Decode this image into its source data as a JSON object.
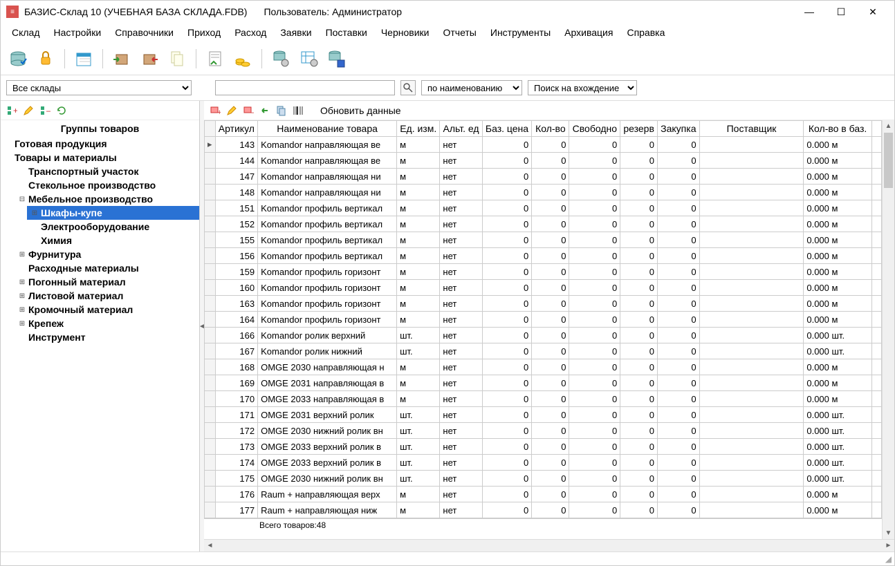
{
  "title": "БАЗИС-Склад 10 (УЧЕБНАЯ БАЗА СКЛАДА.FDB)",
  "user_label": "Пользователь: Администратор",
  "menus": [
    "Склад",
    "Настройки",
    "Справочники",
    "Приход",
    "Расход",
    "Заявки",
    "Поставки",
    "Черновики",
    "Отчеты",
    "Инструменты",
    "Архивация",
    "Справка"
  ],
  "filter": {
    "warehouse_selected": "Все склады",
    "search_value": "",
    "mode_selected": "по наименованию",
    "match_selected": "Поиск на вхождение"
  },
  "sidebar": {
    "title": "Группы товаров",
    "root": [
      {
        "label": "Готовая продукция",
        "children": [],
        "expandable": false
      },
      {
        "label": "Товары и материалы",
        "expanded": true,
        "children": [
          {
            "label": "Транспортный участок"
          },
          {
            "label": "Стекольное производство"
          },
          {
            "label": "Мебельное производство",
            "expandable": true,
            "expanded": true,
            "children": [
              {
                "label": "Шкафы-купе",
                "expandable": true,
                "selected": true
              },
              {
                "label": "Электрооборудование"
              },
              {
                "label": "Химия"
              }
            ]
          },
          {
            "label": "Фурнитура",
            "expandable": true
          },
          {
            "label": "Расходные материалы"
          },
          {
            "label": "Погонный материал",
            "expandable": true
          },
          {
            "label": "Листовой материал",
            "expandable": true
          },
          {
            "label": "Кромочный материал",
            "expandable": true
          },
          {
            "label": "Крепеж",
            "expandable": true
          },
          {
            "label": "Инструмент"
          }
        ]
      }
    ]
  },
  "content_tools": {
    "refresh_label": "Обновить данные"
  },
  "columns": [
    "Артикул",
    "Наименование товара",
    "Ед. изм.",
    "Альт. ед",
    "Баз. цена",
    "Кол-во",
    "Свободно",
    "резерв",
    "Закупка",
    "Поставщик",
    "Кол-во в баз."
  ],
  "rows": [
    {
      "art": "143",
      "name": "Komandor направляющая ве",
      "unit": "м",
      "alt": "нет",
      "price": "0",
      "qty": "0",
      "free": "0",
      "res": "0",
      "buy": "0",
      "sup": "",
      "base": "0.000 м"
    },
    {
      "art": "144",
      "name": "Komandor направляющая ве",
      "unit": "м",
      "alt": "нет",
      "price": "0",
      "qty": "0",
      "free": "0",
      "res": "0",
      "buy": "0",
      "sup": "",
      "base": "0.000 м"
    },
    {
      "art": "147",
      "name": "Komandor направляющая ни",
      "unit": "м",
      "alt": "нет",
      "price": "0",
      "qty": "0",
      "free": "0",
      "res": "0",
      "buy": "0",
      "sup": "",
      "base": "0.000 м"
    },
    {
      "art": "148",
      "name": "Komandor направляющая ни",
      "unit": "м",
      "alt": "нет",
      "price": "0",
      "qty": "0",
      "free": "0",
      "res": "0",
      "buy": "0",
      "sup": "",
      "base": "0.000 м"
    },
    {
      "art": "151",
      "name": "Komandor профиль вертикал",
      "unit": "м",
      "alt": "нет",
      "price": "0",
      "qty": "0",
      "free": "0",
      "res": "0",
      "buy": "0",
      "sup": "",
      "base": "0.000 м"
    },
    {
      "art": "152",
      "name": "Komandor профиль вертикал",
      "unit": "м",
      "alt": "нет",
      "price": "0",
      "qty": "0",
      "free": "0",
      "res": "0",
      "buy": "0",
      "sup": "",
      "base": "0.000 м"
    },
    {
      "art": "155",
      "name": "Komandor профиль вертикал",
      "unit": "м",
      "alt": "нет",
      "price": "0",
      "qty": "0",
      "free": "0",
      "res": "0",
      "buy": "0",
      "sup": "",
      "base": "0.000 м"
    },
    {
      "art": "156",
      "name": "Komandor профиль вертикал",
      "unit": "м",
      "alt": "нет",
      "price": "0",
      "qty": "0",
      "free": "0",
      "res": "0",
      "buy": "0",
      "sup": "",
      "base": "0.000 м"
    },
    {
      "art": "159",
      "name": "Komandor профиль горизонт",
      "unit": "м",
      "alt": "нет",
      "price": "0",
      "qty": "0",
      "free": "0",
      "res": "0",
      "buy": "0",
      "sup": "",
      "base": "0.000 м"
    },
    {
      "art": "160",
      "name": "Komandor профиль горизонт",
      "unit": "м",
      "alt": "нет",
      "price": "0",
      "qty": "0",
      "free": "0",
      "res": "0",
      "buy": "0",
      "sup": "",
      "base": "0.000 м"
    },
    {
      "art": "163",
      "name": "Komandor профиль горизонт",
      "unit": "м",
      "alt": "нет",
      "price": "0",
      "qty": "0",
      "free": "0",
      "res": "0",
      "buy": "0",
      "sup": "",
      "base": "0.000 м"
    },
    {
      "art": "164",
      "name": "Komandor профиль горизонт",
      "unit": "м",
      "alt": "нет",
      "price": "0",
      "qty": "0",
      "free": "0",
      "res": "0",
      "buy": "0",
      "sup": "",
      "base": "0.000 м"
    },
    {
      "art": "166",
      "name": "Komandor ролик верхний",
      "unit": "шт.",
      "alt": "нет",
      "price": "0",
      "qty": "0",
      "free": "0",
      "res": "0",
      "buy": "0",
      "sup": "",
      "base": "0.000 шт."
    },
    {
      "art": "167",
      "name": "Komandor ролик нижний",
      "unit": "шт.",
      "alt": "нет",
      "price": "0",
      "qty": "0",
      "free": "0",
      "res": "0",
      "buy": "0",
      "sup": "",
      "base": "0.000 шт."
    },
    {
      "art": "168",
      "name": "OMGE 2030 направляющая н",
      "unit": "м",
      "alt": "нет",
      "price": "0",
      "qty": "0",
      "free": "0",
      "res": "0",
      "buy": "0",
      "sup": "",
      "base": "0.000 м"
    },
    {
      "art": "169",
      "name": "OMGE 2031 направляющая в",
      "unit": "м",
      "alt": "нет",
      "price": "0",
      "qty": "0",
      "free": "0",
      "res": "0",
      "buy": "0",
      "sup": "",
      "base": "0.000 м"
    },
    {
      "art": "170",
      "name": "OMGE 2033 направляющая в",
      "unit": "м",
      "alt": "нет",
      "price": "0",
      "qty": "0",
      "free": "0",
      "res": "0",
      "buy": "0",
      "sup": "",
      "base": "0.000 м"
    },
    {
      "art": "171",
      "name": "OMGE 2031 верхний ролик",
      "unit": "шт.",
      "alt": "нет",
      "price": "0",
      "qty": "0",
      "free": "0",
      "res": "0",
      "buy": "0",
      "sup": "",
      "base": "0.000 шт."
    },
    {
      "art": "172",
      "name": "OMGE 2030 нижний ролик вн",
      "unit": "шт.",
      "alt": "нет",
      "price": "0",
      "qty": "0",
      "free": "0",
      "res": "0",
      "buy": "0",
      "sup": "",
      "base": "0.000 шт."
    },
    {
      "art": "173",
      "name": "OMGE 2033 верхний ролик в",
      "unit": "шт.",
      "alt": "нет",
      "price": "0",
      "qty": "0",
      "free": "0",
      "res": "0",
      "buy": "0",
      "sup": "",
      "base": "0.000 шт."
    },
    {
      "art": "174",
      "name": "OMGE 2033 верхний ролик в",
      "unit": "шт.",
      "alt": "нет",
      "price": "0",
      "qty": "0",
      "free": "0",
      "res": "0",
      "buy": "0",
      "sup": "",
      "base": "0.000 шт."
    },
    {
      "art": "175",
      "name": "OMGE 2030 нижний ролик вн",
      "unit": "шт.",
      "alt": "нет",
      "price": "0",
      "qty": "0",
      "free": "0",
      "res": "0",
      "buy": "0",
      "sup": "",
      "base": "0.000 шт."
    },
    {
      "art": "176",
      "name": "Raum + направляющая верх",
      "unit": "м",
      "alt": "нет",
      "price": "0",
      "qty": "0",
      "free": "0",
      "res": "0",
      "buy": "0",
      "sup": "",
      "base": "0.000 м"
    },
    {
      "art": "177",
      "name": "Raum + направляющая ниж",
      "unit": "м",
      "alt": "нет",
      "price": "0",
      "qty": "0",
      "free": "0",
      "res": "0",
      "buy": "0",
      "sup": "",
      "base": "0.000 м"
    }
  ],
  "footer": "Всего товаров:48"
}
